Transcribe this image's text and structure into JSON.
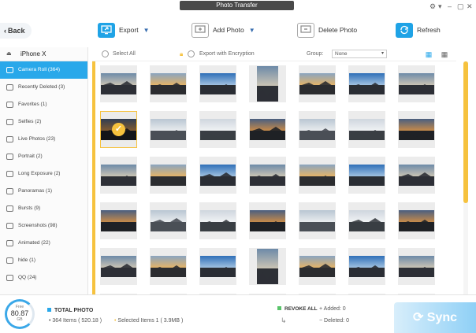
{
  "window": {
    "title": "Photo Transfer"
  },
  "toolbar": {
    "back_label": "Back",
    "export_label": "Export",
    "add_label": "Add Photo",
    "delete_label": "Delete Photo",
    "refresh_label": "Refresh"
  },
  "device": {
    "name": "iPhone X"
  },
  "sidebar": {
    "items": [
      {
        "label": "Camera Roll (364)",
        "icon": "camera-roll-icon",
        "active": true
      },
      {
        "label": "Recently Deleted (3)",
        "icon": "trash-icon"
      },
      {
        "label": "Favorites (1)",
        "icon": "heart-icon"
      },
      {
        "label": "Selfies (2)",
        "icon": "selfie-icon"
      },
      {
        "label": "Live Photos (23)",
        "icon": "live-photo-icon"
      },
      {
        "label": "Portrait (2)",
        "icon": "portrait-icon"
      },
      {
        "label": "Long Exposure (2)",
        "icon": "long-exposure-icon"
      },
      {
        "label": "Panoramas (1)",
        "icon": "panorama-icon"
      },
      {
        "label": "Bursts (9)",
        "icon": "burst-icon"
      },
      {
        "label": "Screenshots (98)",
        "icon": "screenshot-icon"
      },
      {
        "label": "Animated (22)",
        "icon": "animated-icon"
      },
      {
        "label": "hide (1)",
        "icon": "hidden-icon"
      },
      {
        "label": "QQ (24)",
        "icon": "qq-icon"
      }
    ]
  },
  "filter": {
    "select_all": "Select All",
    "export_encryption": "Export with Encryption",
    "group_label": "Group:",
    "group_value": "None"
  },
  "summary": {
    "total_title": "TOTAL PHOTO",
    "items": "364 Items ( 520.18 )",
    "selected": "Selected Items 1 ( 3.9MB )",
    "revoke_label": "REVOKE ALL",
    "added": "Added: 0",
    "deleted": "Deleted: 0",
    "storage_free_label": "Free",
    "storage_value": "80.87",
    "storage_unit": "GB",
    "sync_label": "Sync"
  },
  "colors": {
    "accent": "#29a8ea",
    "selected": "#f6c23e"
  }
}
